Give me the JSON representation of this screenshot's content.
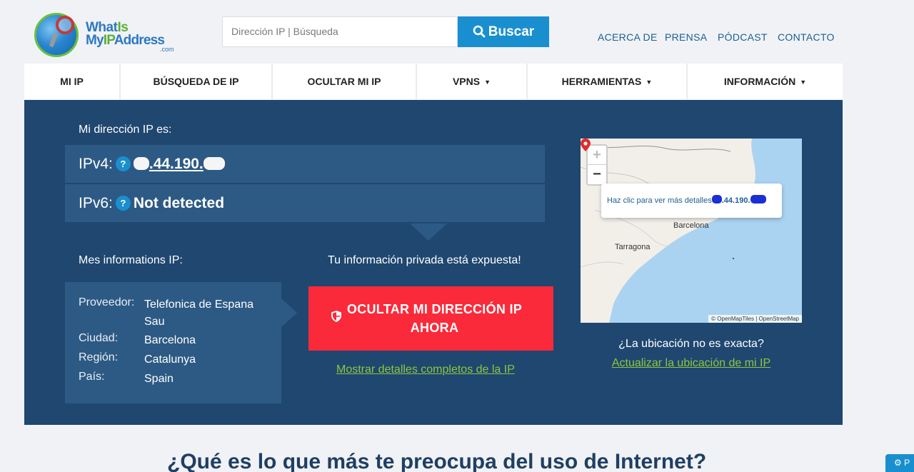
{
  "brand": {
    "line1_a": "What",
    "line1_b": "Is",
    "line2_a": "My",
    "line2_b": "IP",
    "line2_c": "Address",
    "line3": ".com"
  },
  "search": {
    "placeholder": "Dirección IP | Búsqueda",
    "button_label": "Buscar"
  },
  "top_links": [
    "ACERCA DE",
    "PRENSA",
    "PÓDCAST",
    "CONTACTO"
  ],
  "nav": [
    {
      "label": "MI IP",
      "has_dropdown": false
    },
    {
      "label": "BÚSQUEDA DE IP",
      "has_dropdown": false
    },
    {
      "label": "OCULTAR MI IP",
      "has_dropdown": false
    },
    {
      "label": "VPNS",
      "has_dropdown": true
    },
    {
      "label": "HERRAMIENTAS",
      "has_dropdown": true
    },
    {
      "label": "INFORMACIÓN",
      "has_dropdown": true
    }
  ],
  "caret": "▼",
  "ip_section": {
    "title": "Mi dirección IP es:",
    "ipv4_label": "IPv4:",
    "ipv4_value": ".44.190.",
    "ipv6_label": "IPv6:",
    "ipv6_value": "Not detected",
    "help_glyph": "?"
  },
  "info": {
    "title": "Mes informations IP:",
    "rows": [
      {
        "key": "Proveedor:",
        "value": "Telefonica de Espana Sau"
      },
      {
        "key": "Ciudad:",
        "value": "Barcelona"
      },
      {
        "key": "Región:",
        "value": "Catalunya"
      },
      {
        "key": "País:",
        "value": "Spain"
      }
    ]
  },
  "exposed_text": "Tu información privada está expuesta!",
  "hide_button": {
    "line1": "OCULTAR MI DIRECCIÓN IP",
    "line2": "AHORA"
  },
  "details_link": "Mostrar detalles completos de la IP",
  "map": {
    "zoom_in": "+",
    "zoom_out": "−",
    "popup_text": "Haz clic para ver más detalles",
    "popup_ip": ".44.190.",
    "city_barcelona": "Barcelona",
    "city_tarragona": "Tarragona",
    "attribution": "© OpenMapTiles | OpenStreetMap"
  },
  "location_question": "¿La ubicación no es exacta?",
  "update_location_link": "Actualizar la ubicación de mi IP",
  "headline": "¿Qué es lo que más te preocupa del uso de Internet?",
  "settings_fab_label": "P",
  "colors": {
    "panel": "#1f4770",
    "panel_light": "#2d5a84",
    "accent_blue": "#1a8fcf",
    "cta_red": "#fb2a3a",
    "link_green": "#8ec63f"
  }
}
